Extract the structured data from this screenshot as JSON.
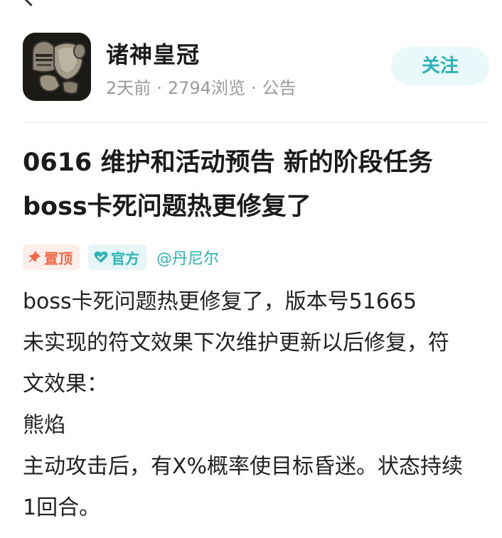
{
  "author": {
    "name": "诸神皇冠",
    "time": "2天前",
    "views": "2794浏览",
    "category": "公告",
    "separator": "·",
    "follow_label": "关注"
  },
  "post": {
    "title_line1": "0616 维护和活动预告 新的阶段任务",
    "title_line2": "boss卡死问题热更修复了",
    "tags": {
      "pinned": "置顶",
      "official": "官方"
    },
    "author_mention": "@丹尼尔",
    "body": [
      "boss卡死问题热更修复了，版本号51665",
      "未实现的符文效果下次维护更新以后修复，符",
      "文效果：",
      "熊焰",
      "主动攻击后，有X%概率使目标昏迷。状态持续",
      "1回合。"
    ]
  },
  "colors": {
    "accent": "#2bb3b7",
    "pinned": "#f2694c",
    "meta": "#9a9a9a"
  },
  "icons": {
    "back": "chevron-left-icon",
    "avatar": "knight-armor-avatar",
    "pinned": "pin-icon",
    "official": "verified-heart-icon"
  }
}
